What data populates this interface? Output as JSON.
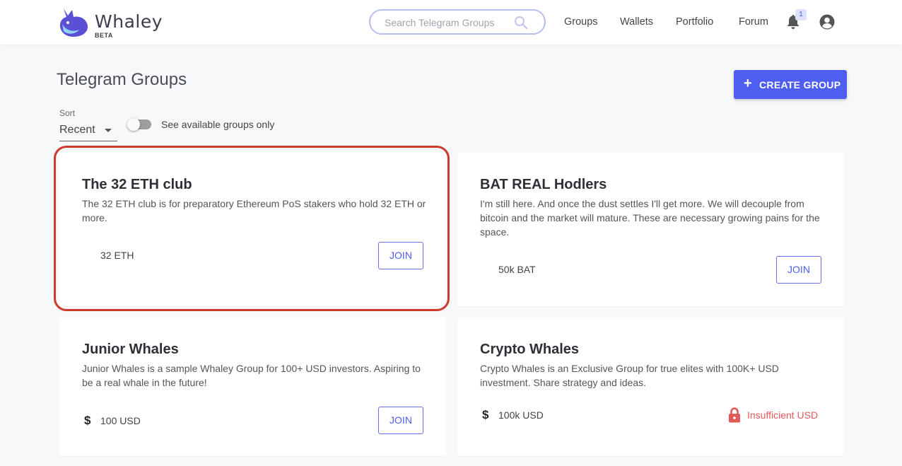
{
  "app": {
    "name": "Whaley",
    "badge": "BETA"
  },
  "search": {
    "placeholder": "Search Telegram Groups"
  },
  "nav": {
    "groups": "Groups",
    "wallets": "Wallets",
    "portfolio": "Portfolio",
    "forum": "Forum"
  },
  "notifications": {
    "count": "1"
  },
  "page": {
    "title": "Telegram Groups",
    "create_label": "CREATE GROUP"
  },
  "sort": {
    "label": "Sort",
    "value": "Recent"
  },
  "filter": {
    "label": "See available groups only",
    "checked": false
  },
  "groups": [
    {
      "title": "The 32 ETH club",
      "description": "The 32 ETH club is for preparatory Ethereum PoS stakers who hold 32 ETH or more.",
      "requirement": "32 ETH",
      "currency_icon": "",
      "action": "JOIN"
    },
    {
      "title": "BAT REAL Hodlers",
      "description": "I'm still here. And once the dust settles I'll get more. We will decouple from bitcoin and the market will mature. These are necessary growing pains for the space.",
      "requirement": "50k BAT",
      "currency_icon": "",
      "action": "JOIN"
    },
    {
      "title": "Junior Whales",
      "description": "Junior Whales is a sample Whaley Group for 100+ USD investors. Aspiring to be a real whale in the future!",
      "requirement": "100 USD",
      "currency_icon": "$",
      "action": "JOIN"
    },
    {
      "title": "Crypto Whales",
      "description": "Crypto Whales is an Exclusive Group for true elites with 100K+ USD investment. Share strategy and ideas.",
      "requirement": "100k USD",
      "currency_icon": "$",
      "status": "Insufficient USD"
    }
  ],
  "colors": {
    "accent": "#4e5ef0",
    "error": "#e05a5a",
    "highlight": "#cc3a2b"
  }
}
